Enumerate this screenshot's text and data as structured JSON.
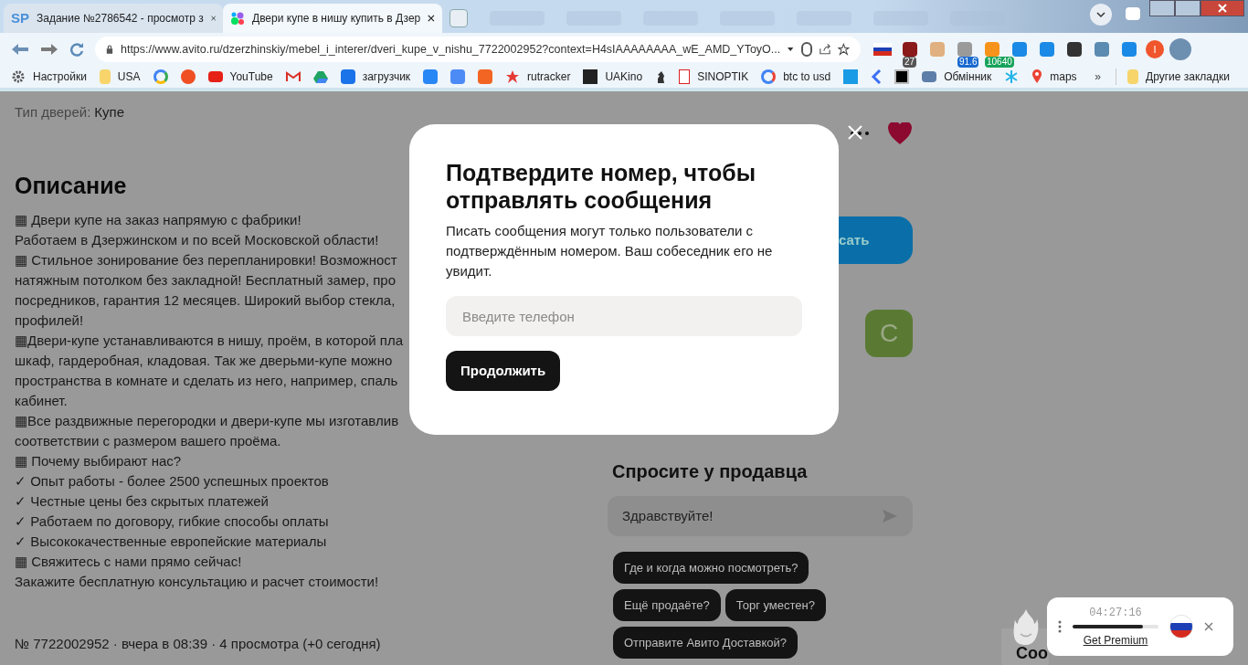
{
  "browser": {
    "tabs": [
      {
        "title": "Задание №2786542 - просмотр з",
        "favicon": "SP",
        "selected": false
      },
      {
        "title": "Двери купе в нишу купить в Дзер",
        "selected": true
      }
    ],
    "url": "https://www.avito.ru/dzerzhinskiy/mebel_i_interer/dveri_kupe_v_nishu_7722002952?context=H4sIAAAAAAAA_wE_AMD_YToyO...",
    "extensions": [
      {
        "kind": "flag"
      },
      {
        "kind": "shield",
        "badge": "27"
      },
      {
        "kind": "face"
      },
      {
        "kind": "coin",
        "badge": "91.6"
      },
      {
        "kind": "bitcoin",
        "badge": "10640"
      },
      {
        "kind": "download"
      },
      {
        "kind": "diamond"
      },
      {
        "kind": "dark"
      },
      {
        "kind": "puzzle"
      },
      {
        "kind": "tray"
      }
    ],
    "profile": {
      "initial": "I"
    },
    "bookmarks": [
      {
        "kind": "link",
        "label": "Настройки"
      },
      {
        "kind": "link",
        "label": "USA"
      },
      {
        "kind": "icon"
      },
      {
        "kind": "icon"
      },
      {
        "kind": "link",
        "label": "YouTube"
      },
      {
        "kind": "icon"
      },
      {
        "kind": "icon"
      },
      {
        "kind": "link",
        "label": "загрузчик"
      },
      {
        "kind": "icon"
      },
      {
        "kind": "icon"
      },
      {
        "kind": "icon"
      },
      {
        "kind": "link",
        "label": "rutracker"
      },
      {
        "kind": "link",
        "label": "UAKino"
      },
      {
        "kind": "icon"
      },
      {
        "kind": "link",
        "label": "SINOPTIK"
      },
      {
        "kind": "link",
        "label": "btc to usd"
      },
      {
        "kind": "icon"
      },
      {
        "kind": "icon"
      },
      {
        "kind": "icon"
      },
      {
        "kind": "link",
        "label": "Обмінник"
      },
      {
        "kind": "icon"
      },
      {
        "kind": "link",
        "label": "maps"
      }
    ],
    "more_bookmarks": "»",
    "other_bookmarks": "Другие закладки"
  },
  "listing": {
    "param_label": "Тип дверей:",
    "param_value": "Купе",
    "heading": "Описание",
    "description_lines": [
      "▦ Двери купе на заказ напрямую с фабрики!",
      "Работаем в Дзержинском и по всей Московской области!",
      "▦ Стильное зонирование без перепланировки! Возможност",
      "натяжным потолком без закладной! Бесплатный замер, про",
      "посредников, гарантия 12 месяцев. Широкий выбор стекла,",
      "профилей!",
      "▦Двери-купе устанавливаются в нишу, проём, в которой пла",
      "шкаф, гардеробная, кладовая. Так же дверьми-купе можно",
      "пространства в комнате и сделать из него, например, спаль",
      "кабинет.",
      "▦Все раздвижные перегородки и двери-купе мы изготавлив",
      "соответствии с размером вашего проёма.",
      "▦ Почему выбирают нас?",
      "✓ Опыт работы - более 2500 успешных проектов",
      "✓ Честные цены без скрытых платежей",
      "✓ Работаем по договору, гибкие способы оплаты",
      "✓ Высококачественные европейские материалы",
      "▦ Свяжитесь с нами прямо сейчас!",
      "Закажите бесплатную консультацию и расчет стоимости!"
    ],
    "footer": "№ 7722002952 · вчера в 08:39 · 4 просмотра (+0 сегодня)"
  },
  "sidebar": {
    "favorite": true,
    "write_button": "сать",
    "avatar_letter": "С",
    "ask_heading": "Спросите у продавца",
    "message_value": "Здравствуйте!",
    "quick_questions": [
      "Где и когда можно посмотреть?",
      "Ещё продаёте?",
      "Торг уместен?",
      "Отправите Авито Доставкой?"
    ],
    "next_heading": "Соо"
  },
  "modal": {
    "title": "Подтвердите номер, чтобы отправлять сообщения",
    "text": "Писать сообщения могут только пользователи с подтверждённым номером. Ваш собеседник его не увидит.",
    "phone_placeholder": "Введите телефон",
    "continue_button": "Продолжить"
  },
  "vpn_widget": {
    "time": "04:27:16",
    "level": 0.82,
    "link": "Get Premium"
  }
}
